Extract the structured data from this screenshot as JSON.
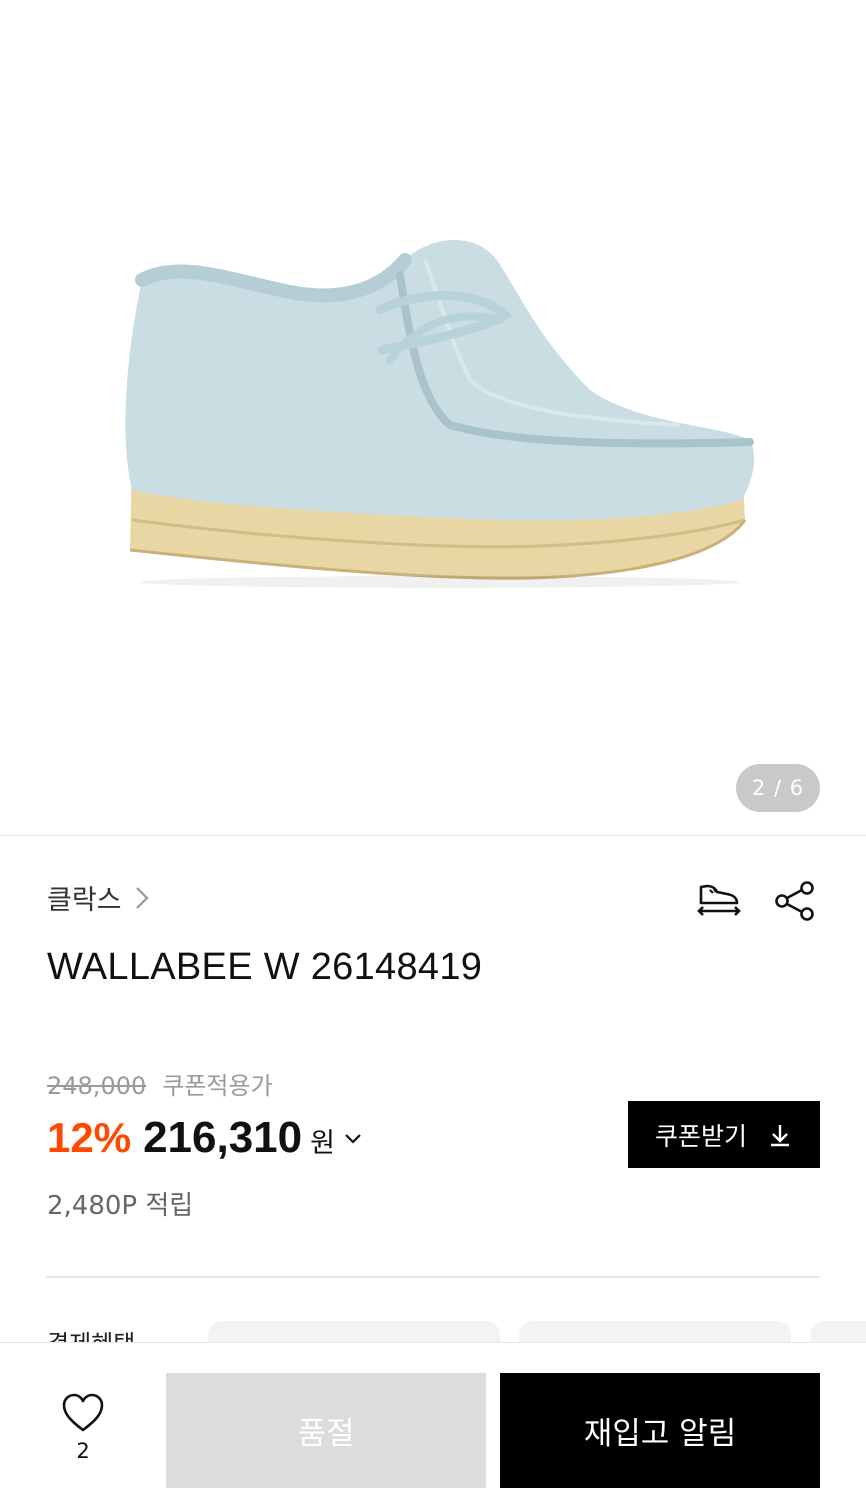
{
  "gallery": {
    "image_alt": "product-shoe-image",
    "page_indicator": "2 / 6"
  },
  "product": {
    "brand": "클락스",
    "title": "WALLABEE W 26148419"
  },
  "price": {
    "original": "248,000",
    "coupon_label": "쿠폰적용가",
    "discount": "12%",
    "sale": "216,310",
    "currency": "원",
    "points": "2,480P 적립"
  },
  "coupon_button": {
    "label": "쿠폰받기"
  },
  "benefits": {
    "label": "결제혜택"
  },
  "bottom": {
    "like_count": "2",
    "soldout_label": "품절",
    "restock_label": "재입고 알림"
  },
  "colors": {
    "discount": "#ff4800",
    "primary_button": "#000000",
    "disabled_button": "#dcdcdc",
    "shoe_upper": "#c9dde3",
    "sole": "#e8d6a4"
  },
  "icons": [
    "chevron-right-icon",
    "size-guide-shoe-icon",
    "share-icon",
    "chevron-down-icon",
    "download-icon",
    "heart-icon"
  ]
}
